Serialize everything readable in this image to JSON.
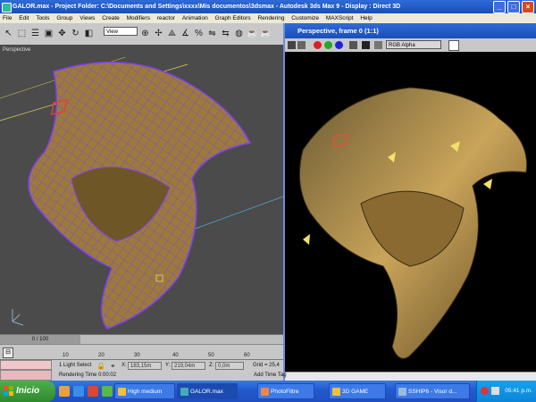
{
  "title": {
    "text": "GALOR.max    - Project Folder: C:\\Documents and Settings\\xxxx\\Mis documentos\\3dsmax    - Autodesk 3ds Max 9      - Display : Direct 3D"
  },
  "menu": [
    "File",
    "Edit",
    "Tools",
    "Group",
    "Views",
    "Create",
    "Modifiers",
    "reactor",
    "Animation",
    "Graph Editors",
    "Rendering",
    "Customize",
    "MAXScript",
    "Help"
  ],
  "toolbar": {
    "view_select": "View"
  },
  "viewport": {
    "label": "Perspective"
  },
  "render_window": {
    "title": "Perspective, frame 0 (1:1)",
    "channel": "RGB Alpha"
  },
  "timeline": {
    "frame_indicator": "0 / 100",
    "ticks": [
      "10",
      "20",
      "30",
      "40",
      "50",
      "60"
    ]
  },
  "status": {
    "light_select": "1 Light Select",
    "x_label": "X:",
    "x_value": "183,15m",
    "y_label": "Y:",
    "y_value": "219,04m",
    "z_label": "Z:",
    "z_value": "0,0m",
    "grid": "Grid = 25,4",
    "rendering_time": "Rendering Time  0:00:02",
    "add_time_tag": "Add Time Tag"
  },
  "taskbar": {
    "start_label": "Inicio",
    "tasks": [
      "High medium",
      "GALOR.max",
      "PhotoFiltre",
      "3D GAME",
      "SSHIP6 - Visor d..."
    ],
    "clock": "05:41 p.m."
  },
  "colors": {
    "wireframe": "#7b3ff2",
    "hull": "#b08a3c",
    "title_blue": "#245ad0"
  }
}
